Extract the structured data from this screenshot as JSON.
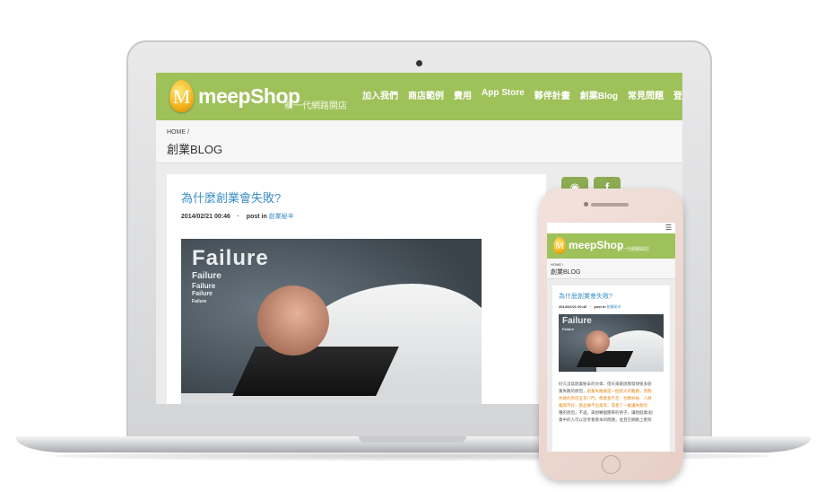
{
  "site": {
    "logo_letter": "M",
    "logo_name": "meepShop",
    "logo_tagline": "新一代網路開店",
    "nav": [
      "加入我們",
      "商店範例",
      "費用",
      "App Store",
      "夥伴計畫",
      "創業Blog",
      "常見問題",
      "登入"
    ],
    "breadcrumb_home": "HOME /",
    "page_title": "創業BLOG"
  },
  "post": {
    "title": "為什麼創業會失敗?",
    "date": "2014/02/21 00:46",
    "separator": "·",
    "post_in": "post in",
    "category": "創業秘辛",
    "image_words": [
      "Failure",
      "Failure",
      "Failure",
      "Failure",
      "Failure"
    ]
  },
  "social": {
    "rss_glyph": "◉",
    "facebook_glyph": "f"
  },
  "mobile": {
    "menu_glyph": "☰",
    "body_lines": [
      {
        "text": "好久沒寫創業秘辛的文章，借天來跟說我發現很多創",
        "highlight": false
      },
      {
        "text": "業失敗的原因，",
        "highlight": false
      },
      {
        "text": "創業失敗總是一個很大的難題，而我",
        "highlight": true
      },
      {
        "text": "失敗的原因五花八門，像資金不足、合夥糾紛、人員",
        "highlight": true
      },
      {
        "text": "離開不好，產品做不出來等，或者了一推讓失敗的",
        "highlight": true
      },
      {
        "text": "種的原因，不過，來想轉個簡單的例子，讓想創業/創",
        "highlight": false
      },
      {
        "text": "業中的人可以思考看看本的問題，並且在網路上看到",
        "highlight": false
      }
    ]
  },
  "colors": {
    "brand_green": "#9fc15a",
    "link_blue": "#3b8fc7",
    "highlight_orange": "#e58a1e"
  }
}
